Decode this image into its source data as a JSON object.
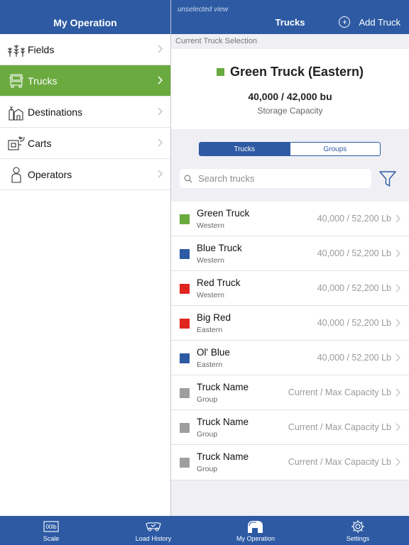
{
  "left": {
    "title": "My Operation",
    "items": [
      {
        "label": "Fields",
        "icon": "fields-icon"
      },
      {
        "label": "Trucks",
        "icon": "truck-icon",
        "active": true
      },
      {
        "label": "Destinations",
        "icon": "destinations-icon"
      },
      {
        "label": "Carts",
        "icon": "cart-icon"
      },
      {
        "label": "Operators",
        "icon": "operator-icon"
      }
    ]
  },
  "right": {
    "unselected_view": "unselected view",
    "title": "Trucks",
    "add_label": "Add Truck",
    "current_selection_label": "Current Truck Selection",
    "selected": {
      "name": "Green Truck (Eastern)",
      "color": "#6aaa3f",
      "capacity": "40,000 / 42,000 bu",
      "capacity_label": "Storage Capacity"
    },
    "segments": [
      "Trucks",
      "Groups"
    ],
    "search_placeholder": "Search trucks",
    "trucks": [
      {
        "name": "Green Truck",
        "group": "Western",
        "capacity": "40,000 / 52,200 Lb",
        "color": "#6aaa3f"
      },
      {
        "name": "Blue Truck",
        "group": "Western",
        "capacity": "40,000 / 52,200 Lb",
        "color": "#2d5aa3"
      },
      {
        "name": "Red Truck",
        "group": "Western",
        "capacity": "40,000 / 52,200 Lb",
        "color": "#e0251f"
      },
      {
        "name": "Big Red",
        "group": "Eastern",
        "capacity": "40,000 / 52,200 Lb",
        "color": "#e0251f"
      },
      {
        "name": "Ol' Blue",
        "group": "Eastern",
        "capacity": "40,000 / 52,200 Lb",
        "color": "#2d5aa3"
      },
      {
        "name": "Truck Name",
        "group": "Group",
        "capacity": "Current / Max Capacity Lb",
        "color": "#9e9e9e"
      },
      {
        "name": "Truck Name",
        "group": "Group",
        "capacity": "Current / Max Capacity Lb",
        "color": "#9e9e9e"
      },
      {
        "name": "Truck Name",
        "group": "Group",
        "capacity": "Current / Max Capacity Lb",
        "color": "#9e9e9e"
      }
    ]
  },
  "tabbar": {
    "scale_icon_text": "00lb",
    "tabs": [
      {
        "label": "Scale",
        "icon": "scale-icon"
      },
      {
        "label": "Load History",
        "icon": "load-history-icon"
      },
      {
        "label": "My Operation",
        "icon": "my-operation-icon",
        "active": true
      },
      {
        "label": "Settings",
        "icon": "gear-icon"
      }
    ]
  },
  "colors": {
    "brand_blue": "#2d5aa3",
    "active_green": "#6aaa3f"
  }
}
